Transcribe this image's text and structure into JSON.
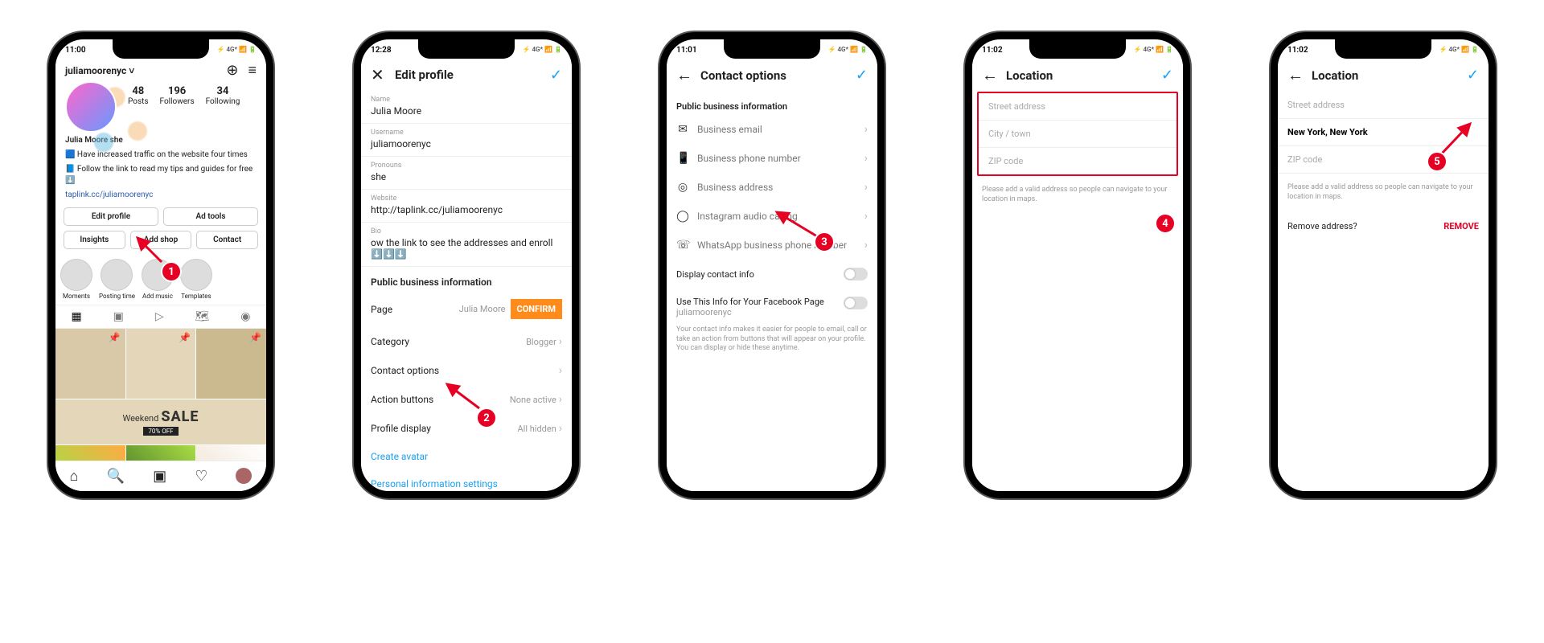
{
  "statusbar": {
    "right": "⚡ 4G* 📶 🔋"
  },
  "phone1": {
    "time": "11:00",
    "username": "juliamoorenyc",
    "stats": {
      "posts_n": "48",
      "posts_l": "Posts",
      "followers_n": "196",
      "followers_l": "Followers",
      "following_n": "34",
      "following_l": "Following"
    },
    "name_line": "Julia Moore  she",
    "bio1": "🟦 Have increased traffic on the website four times",
    "bio2": "📘 Follow the link to read my tips and guides for free ⬇️",
    "bio_link": "taplink.cc/juliamoorenyc",
    "buttons": {
      "edit": "Edit profile",
      "adtools": "Ad tools",
      "insights": "Insights",
      "addshop": "Add shop",
      "contact": "Contact"
    },
    "stories": [
      "Moments",
      "Posting time",
      "Add music",
      "Templates"
    ],
    "sale_weekend": "Weekend",
    "sale_big": "SALE",
    "sale_tag": "70%  OFF",
    "badge": "1"
  },
  "phone2": {
    "time": "12:28",
    "title": "Edit profile",
    "fields": {
      "name_l": "Name",
      "name_v": "Julia Moore",
      "user_l": "Username",
      "user_v": "juliamoorenyc",
      "pron_l": "Pronouns",
      "pron_v": "she",
      "web_l": "Website",
      "web_v": "http://taplink.cc/juliamoorenyc",
      "bio_l": "Bio",
      "bio_v": "ow the link to see the addresses and enroll ⬇️⬇️⬇️"
    },
    "section": "Public business information",
    "rows": {
      "page_l": "Page",
      "page_v": "Julia Moore",
      "confirm": "CONFIRM",
      "cat_l": "Category",
      "cat_v": "Blogger",
      "contact_l": "Contact options",
      "actions_l": "Action buttons",
      "actions_v": "None active",
      "profdisp_l": "Profile display",
      "profdisp_v": "All hidden"
    },
    "links": {
      "avatar": "Create avatar",
      "personal": "Personal information settings"
    },
    "badge": "2"
  },
  "phone3": {
    "time": "11:01",
    "title": "Contact options",
    "section": "Public business information",
    "opts": {
      "email": "Business email",
      "phone": "Business phone number",
      "address": "Business address",
      "audio": "Instagram audio calling",
      "whatsapp": "WhatsApp business phone number"
    },
    "toggle1": "Display contact info",
    "toggle2a": "Use This Info for Your Facebook Page",
    "toggle2b": "juliamoorenyc",
    "helper": "Your contact info makes it easier for people to email, call or take an action from buttons that will appear on your profile. You can display or hide these anytime.",
    "badge": "3"
  },
  "phone4": {
    "time": "11:02",
    "title": "Location",
    "street": "Street address",
    "city": "City / town",
    "zip": "ZIP code",
    "helper": "Please add a valid address so people can navigate to your location in maps.",
    "badge": "4"
  },
  "phone5": {
    "time": "11:02",
    "title": "Location",
    "street": "Street address",
    "city": "New York, New York",
    "zip": "ZIP code",
    "helper": "Please add a valid address so people can navigate to your location in maps.",
    "remove_q": "Remove address?",
    "remove": "REMOVE",
    "badge": "5"
  }
}
